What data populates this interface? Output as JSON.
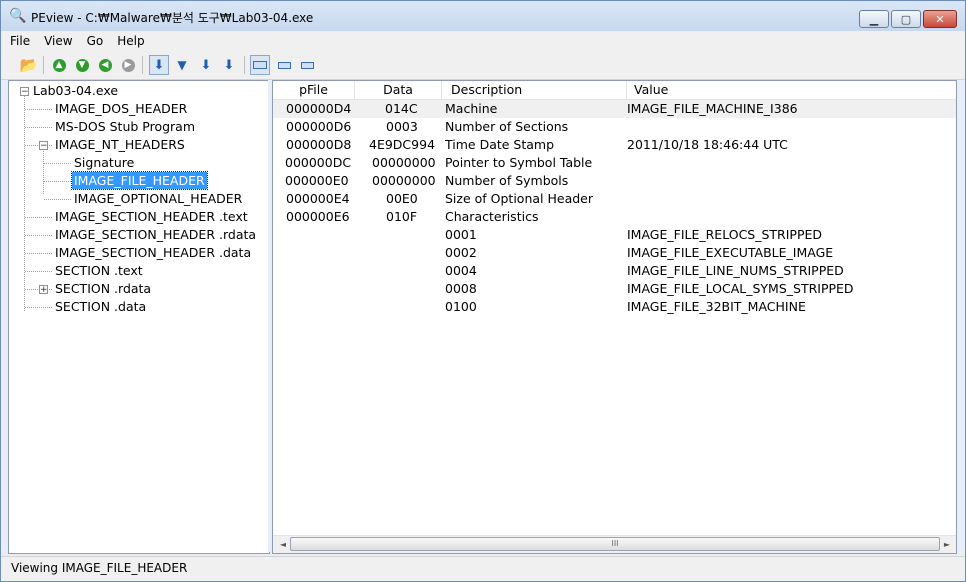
{
  "window": {
    "title": "PEview - C:₩Malware₩분석 도구₩Lab03-04.exe",
    "minimize": "▁",
    "maximize": "▢",
    "close": "✕"
  },
  "menu": [
    "File",
    "View",
    "Go",
    "Help"
  ],
  "tree": {
    "root": "Lab03-04.exe",
    "items": [
      "IMAGE_DOS_HEADER",
      "MS-DOS Stub Program",
      "IMAGE_NT_HEADERS",
      "Signature",
      "IMAGE_FILE_HEADER",
      "IMAGE_OPTIONAL_HEADER",
      "IMAGE_SECTION_HEADER .text",
      "IMAGE_SECTION_HEADER .rdata",
      "IMAGE_SECTION_HEADER .data",
      "SECTION .text",
      "SECTION .rdata",
      "SECTION .data"
    ],
    "selected": "IMAGE_FILE_HEADER",
    "expanded_mark": "−",
    "collapsed_mark": "+"
  },
  "table": {
    "columns": [
      "pFile",
      "Data",
      "Description",
      "Value"
    ],
    "rows": [
      [
        "000000D4",
        "014C",
        "Machine",
        "IMAGE_FILE_MACHINE_I386"
      ],
      [
        "000000D6",
        "0003",
        "Number of Sections",
        ""
      ],
      [
        "000000D8",
        "4E9DC994",
        "Time Date Stamp",
        "2011/10/18  18:46:44 UTC"
      ],
      [
        "000000DC",
        "00000000",
        "Pointer to Symbol Table",
        ""
      ],
      [
        "000000E0",
        "00000000",
        "Number of Symbols",
        ""
      ],
      [
        "000000E4",
        "00E0",
        "Size of Optional Header",
        ""
      ],
      [
        "000000E6",
        "010F",
        "Characteristics",
        ""
      ],
      [
        "",
        "",
        "0001",
        "IMAGE_FILE_RELOCS_STRIPPED"
      ],
      [
        "",
        "",
        "0002",
        "IMAGE_FILE_EXECUTABLE_IMAGE"
      ],
      [
        "",
        "",
        "0004",
        "IMAGE_FILE_LINE_NUMS_STRIPPED"
      ],
      [
        "",
        "",
        "0008",
        "IMAGE_FILE_LOCAL_SYMS_STRIPPED"
      ],
      [
        "",
        "",
        "0100",
        "IMAGE_FILE_32BIT_MACHINE"
      ]
    ]
  },
  "scrollbar": {
    "left_arrow": "◄",
    "right_arrow": "►",
    "grip": "III"
  },
  "status": "Viewing IMAGE_FILE_HEADER"
}
